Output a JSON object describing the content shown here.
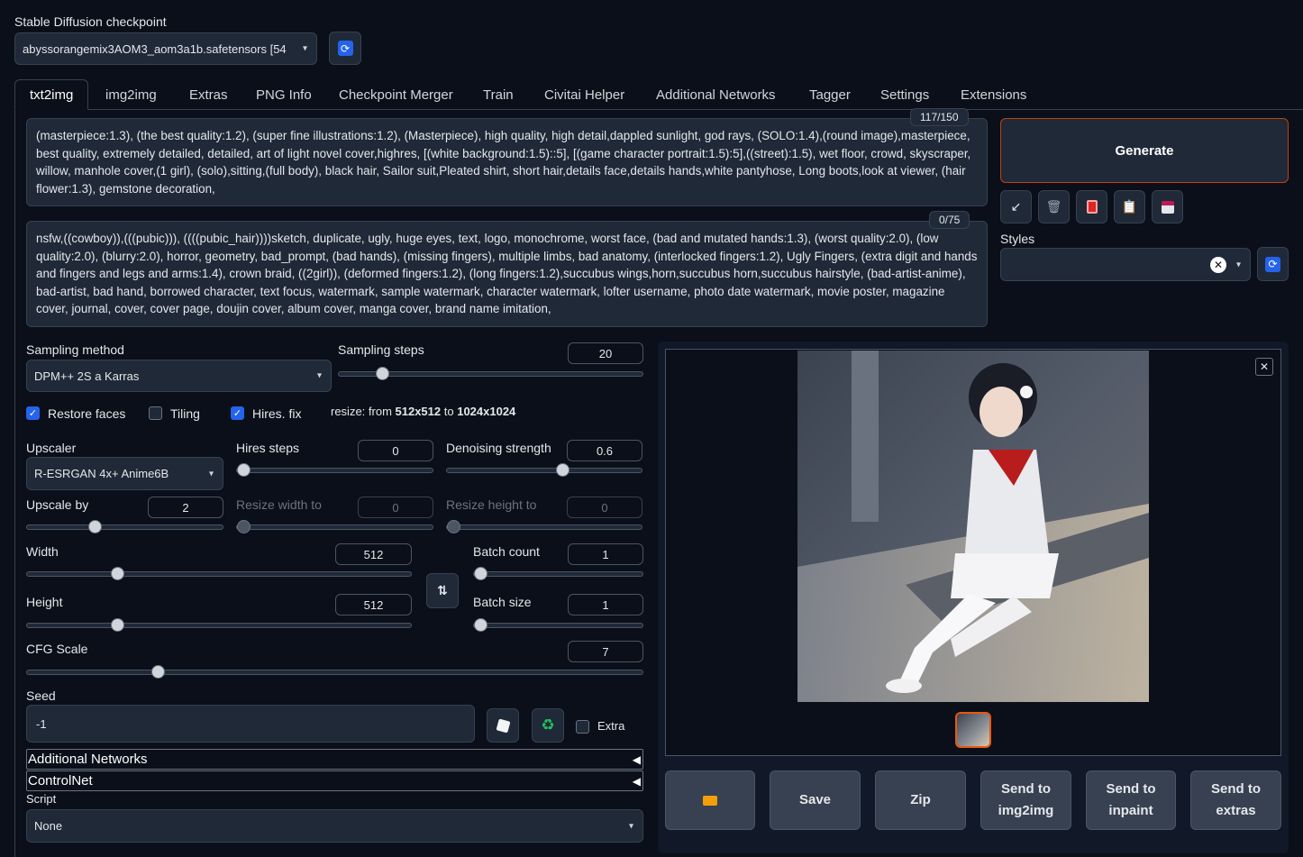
{
  "checkpoint": {
    "label": "Stable Diffusion checkpoint",
    "value": "abyssorangemix3AOM3_aom3a1b.safetensors [54"
  },
  "tabs": [
    "txt2img",
    "img2img",
    "Extras",
    "PNG Info",
    "Checkpoint Merger",
    "Train",
    "Civitai Helper",
    "Additional Networks",
    "Tagger",
    "Settings",
    "Extensions"
  ],
  "prompt": {
    "counter": "117/150",
    "text": "(masterpiece:1.3), (the best quality:1.2), (super fine illustrations:1.2), (Masterpiece), high quality, high detail,dappled sunlight, god rays, (SOLO:1.4),(round image),masterpiece, best quality, extremely detailed, detailed, art of light novel cover,highres, [(white background:1.5)::5], [(game character portrait:1.5):5],((street):1.5), wet floor, crowd, skyscraper, willow, manhole cover,(1 girl), (solo),sitting,(full body), black hair, Sailor suit,Pleated shirt, short hair,details face,details hands,white pantyhose, Long boots,look at viewer, (hair flower:1.3), gemstone decoration,"
  },
  "negative_prompt": {
    "counter": "0/75",
    "text": "nsfw,((cowboy)),(((pubic))), ((((pubic_hair))))sketch, duplicate, ugly, huge eyes, text, logo, monochrome, worst face, (bad and mutated hands:1.3), (worst quality:2.0), (low quality:2.0), (blurry:2.0), horror, geometry, bad_prompt, (bad hands), (missing fingers), multiple limbs, bad anatomy, (interlocked fingers:1.2), Ugly Fingers, (extra digit and hands and fingers and legs and arms:1.4), crown braid, ((2girl)), (deformed fingers:1.2), (long fingers:1.2),succubus wings,horn,succubus horn,succubus hairstyle, (bad-artist-anime), bad-artist, bad hand, borrowed character, text focus, watermark, sample watermark, character watermark, lofter username, photo date watermark, movie poster, magazine cover, journal, cover, cover page, doujin cover, album cover, manga cover, brand name imitation,"
  },
  "generate_label": "Generate",
  "styles_label": "Styles",
  "sampling": {
    "method_label": "Sampling method",
    "method_value": "DPM++ 2S a Karras",
    "steps_label": "Sampling steps",
    "steps_value": "20",
    "steps_fraction": 0.13
  },
  "checks": {
    "restore_faces": "Restore faces",
    "tiling": "Tiling",
    "hires_fix": "Hires. fix",
    "resize_prefix": "resize: from ",
    "resize_from": "512x512",
    "resize_mid": " to ",
    "resize_to": "1024x1024"
  },
  "hires": {
    "upscaler_label": "Upscaler",
    "upscaler_value": "R-ESRGAN 4x+ Anime6B",
    "steps_label": "Hires steps",
    "steps_value": "0",
    "denoise_label": "Denoising strength",
    "denoise_value": "0.6",
    "upscale_label": "Upscale by",
    "upscale_value": "2",
    "rw_label": "Resize width to",
    "rw_value": "0",
    "rh_label": "Resize height to",
    "rh_value": "0"
  },
  "size": {
    "width_label": "Width",
    "width_value": "512",
    "height_label": "Height",
    "height_value": "512",
    "batch_count_label": "Batch count",
    "batch_count_value": "1",
    "batch_size_label": "Batch size",
    "batch_size_value": "1"
  },
  "cfg": {
    "label": "CFG Scale",
    "value": "7"
  },
  "seed": {
    "label": "Seed",
    "value": "-1",
    "extra_label": "Extra"
  },
  "accordions": [
    "Additional Networks",
    "ControlNet"
  ],
  "script": {
    "label": "Script",
    "value": "None"
  },
  "actions": {
    "save": "Save",
    "zip": "Zip",
    "send_img2img": "Send to img2img",
    "send_inpaint": "Send to inpaint",
    "send_extras": "Send to extras"
  },
  "colors": {
    "accent_generate": "#c2410c",
    "checkbox": "#2563eb",
    "background": "#0b0f19"
  }
}
